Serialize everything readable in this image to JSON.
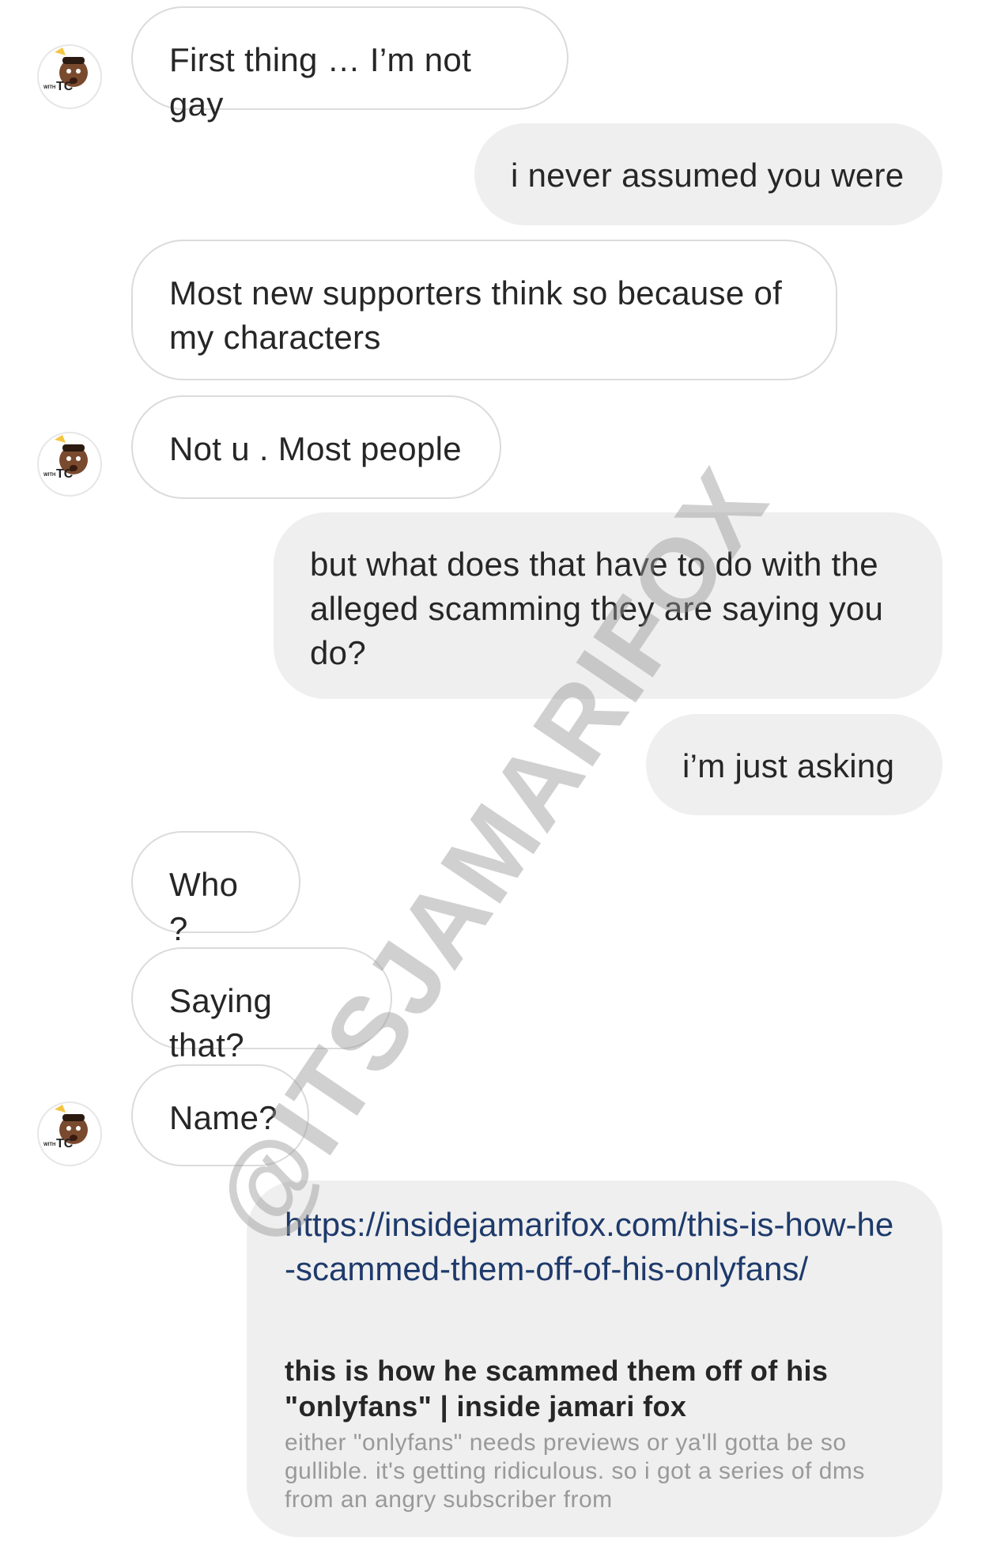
{
  "thread": {
    "messages": [
      {
        "sender": "them",
        "text": "First thing … I’m not gay"
      },
      {
        "sender": "me",
        "text": "i never assumed you were"
      },
      {
        "sender": "them",
        "text": "Most new supporters think so because of my characters"
      },
      {
        "sender": "them",
        "text": "Not u . Most people"
      },
      {
        "sender": "me",
        "text": "but what does that have to do with the alleged scamming they are saying you do?"
      },
      {
        "sender": "me",
        "text": "i’m just asking"
      },
      {
        "sender": "them",
        "text": "Who ?"
      },
      {
        "sender": "them",
        "text": "Saying that?"
      },
      {
        "sender": "them",
        "text": "Name?"
      }
    ],
    "link_preview": {
      "url": "https://insidejamarifox.com/this-is-how-he-scammed-them-off-of-his-onlyfans/",
      "title": "this is how he scammed them off of his \"onlyfans\" | inside jamari fox",
      "description": "either \"onlyfans\" needs previews or ya'll gotta be so gullible. it's getting ridiculous. so i got a series of dms from an angry subscriber from"
    }
  },
  "avatar": {
    "badge_small": "WITH",
    "badge_large": "TC"
  },
  "watermark": "@ITSJAMARIFOX",
  "colors": {
    "incoming_border": "#dbdbdb",
    "outgoing_bg": "#efefef",
    "link": "#1e3a6b",
    "text": "#262626",
    "muted": "#999999"
  }
}
